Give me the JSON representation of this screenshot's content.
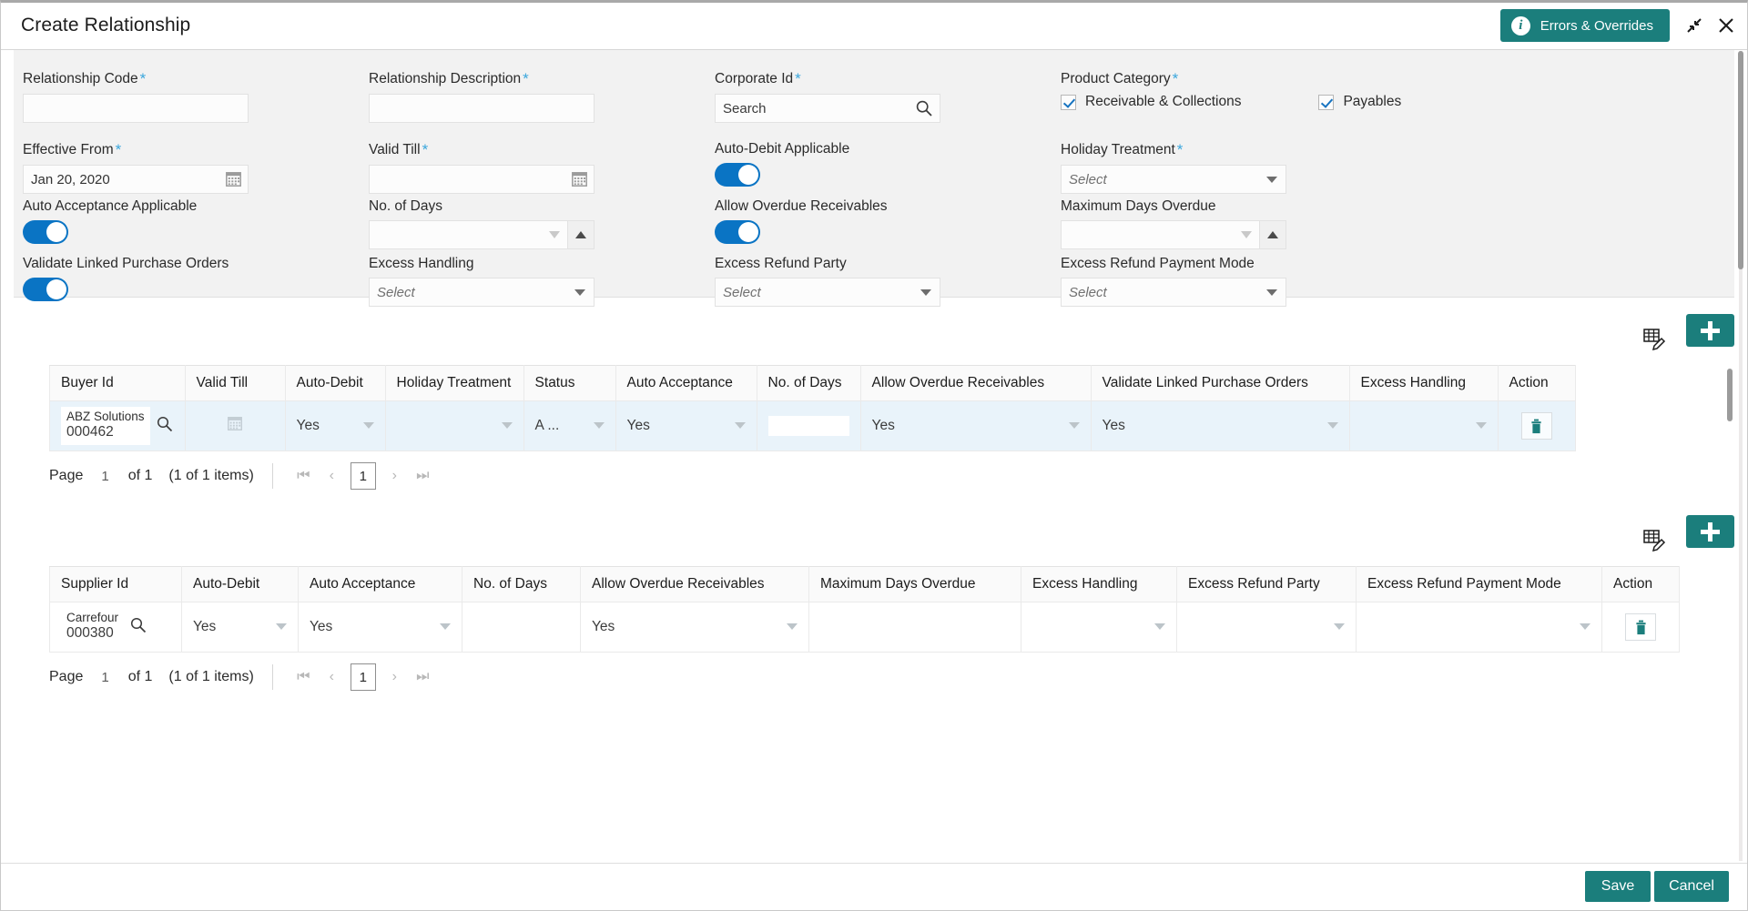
{
  "window": {
    "title": "Create Relationship",
    "errors_overrides_label": "Errors & Overrides",
    "info_icon": "info-icon",
    "minimize_icon": "collapse-icon",
    "close_icon": "close-icon",
    "accent_color": "#1b7e7c",
    "toggle_on_color": "#0a74c4",
    "required_marker": "*"
  },
  "form": {
    "relationship_code": {
      "label": "Relationship Code",
      "required": true,
      "value": "",
      "placeholder": ""
    },
    "relationship_description": {
      "label": "Relationship Description",
      "required": true,
      "value": "",
      "placeholder": ""
    },
    "corporate_id": {
      "label": "Corporate Id",
      "required": true,
      "value": "",
      "placeholder": "Search",
      "icon": "search-icon"
    },
    "product_category": {
      "label": "Product Category",
      "required": true,
      "options": [
        {
          "label": "Receivable & Collections",
          "checked": true
        },
        {
          "label": "Payables",
          "checked": true
        }
      ]
    },
    "effective_from": {
      "label": "Effective From",
      "required": true,
      "value": "Jan 20, 2020",
      "icon": "calendar-icon"
    },
    "valid_till": {
      "label": "Valid Till",
      "required": true,
      "value": "",
      "icon": "calendar-icon"
    },
    "auto_debit_applicable": {
      "label": "Auto-Debit Applicable",
      "required": false,
      "on": true
    },
    "holiday_treatment": {
      "label": "Holiday Treatment",
      "required": true,
      "value": "Select"
    },
    "auto_acceptance_applicable": {
      "label": "Auto Acceptance Applicable",
      "required": false,
      "on": true
    },
    "no_of_days": {
      "label": "No. of Days",
      "required": false,
      "value": ""
    },
    "allow_overdue_receivables": {
      "label": "Allow Overdue Receivables",
      "required": false,
      "on": true
    },
    "maximum_days_overdue": {
      "label": "Maximum Days Overdue",
      "required": false,
      "value": ""
    },
    "validate_linked_purchase_orders": {
      "label": "Validate Linked Purchase Orders",
      "required": false,
      "on": true
    },
    "excess_handling": {
      "label": "Excess Handling",
      "required": false,
      "value": "Select"
    },
    "excess_refund_party": {
      "label": "Excess Refund Party",
      "required": false,
      "value": "Select"
    },
    "excess_refund_payment_mode": {
      "label": "Excess Refund Payment Mode",
      "required": false,
      "value": "Select"
    }
  },
  "buyer_table": {
    "edit_icon": "table-edit-icon",
    "add_icon": "add-icon",
    "columns": [
      "Buyer Id",
      "Valid Till",
      "Auto-Debit",
      "Holiday Treatment",
      "Status",
      "Auto Acceptance",
      "No. of Days",
      "Allow Overdue Receivables",
      "Validate Linked Purchase Orders",
      "Excess Handling",
      "Action"
    ],
    "rows": [
      {
        "buyer_id_name": "ABZ Solutions",
        "buyer_id_code": "000462",
        "valid_till": "",
        "auto_debit": "Yes",
        "holiday_treatment": "",
        "status": "A ...",
        "auto_acceptance": "Yes",
        "no_of_days": "",
        "allow_overdue_receivables": "Yes",
        "validate_linked_purchase_orders": "Yes",
        "excess_handling": "",
        "action_icon": "delete-icon"
      }
    ],
    "pager": {
      "page_label": "Page",
      "page_number": "1",
      "of_label": "of 1",
      "items_label": "(1 of 1 items)",
      "first_icon": "first-page-icon",
      "prev_icon": "prev-page-icon",
      "current_page": "1",
      "next_icon": "next-page-icon",
      "last_icon": "last-page-icon"
    }
  },
  "supplier_table": {
    "edit_icon": "table-edit-icon",
    "add_icon": "add-icon",
    "columns": [
      "Supplier Id",
      "Auto-Debit",
      "Auto Acceptance",
      "No. of Days",
      "Allow Overdue Receivables",
      "Maximum Days Overdue",
      "Excess Handling",
      "Excess Refund Party",
      "Excess Refund Payment Mode",
      "Action"
    ],
    "rows": [
      {
        "supplier_id_name": "Carrefour",
        "supplier_id_code": "000380",
        "auto_debit": "Yes",
        "auto_acceptance": "Yes",
        "no_of_days": "",
        "allow_overdue_receivables": "Yes",
        "maximum_days_overdue": "",
        "excess_handling": "",
        "excess_refund_party": "",
        "excess_refund_payment_mode": "",
        "action_icon": "delete-icon"
      }
    ],
    "pager": {
      "page_label": "Page",
      "page_number": "1",
      "of_label": "of 1",
      "items_label": "(1 of 1 items)",
      "first_icon": "first-page-icon",
      "prev_icon": "prev-page-icon",
      "current_page": "1",
      "next_icon": "next-page-icon",
      "last_icon": "last-page-icon"
    }
  },
  "footer": {
    "save_label": "Save",
    "cancel_label": "Cancel"
  }
}
